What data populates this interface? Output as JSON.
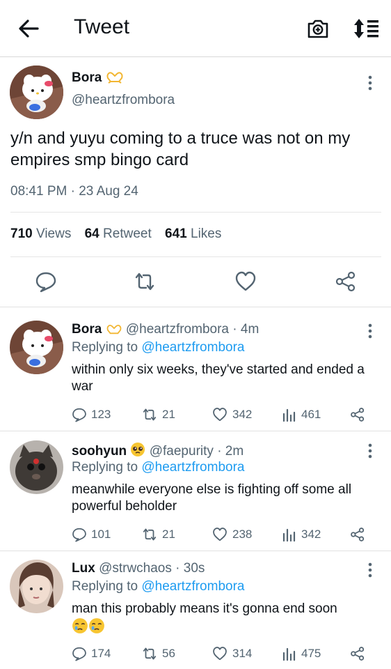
{
  "header": {
    "title": "Tweet"
  },
  "tweet": {
    "author": {
      "name": "Bora",
      "name_emoji": "heart-hands-emoji",
      "handle": "@heartzfrombora"
    },
    "text": "y/n and yuyu coming to a truce was not on my empires smp bingo card",
    "timestamp": "08:41 PM · 23 Aug 24",
    "stats": {
      "views_count": "710",
      "views_label": "Views",
      "retweet_count": "64",
      "retweet_label": "Retweet",
      "likes_count": "641",
      "likes_label": "Likes"
    }
  },
  "replies": [
    {
      "name": "Bora",
      "name_emoji": "heart-hands-emoji",
      "handle": "@heartzfrombora",
      "time": "· 4m",
      "replying_prefix": "Replying to",
      "replying_to": "@heartzfrombora",
      "text": "within only six weeks, they've started and ended a war",
      "reply_count": "123",
      "retweet_count": "21",
      "like_count": "342",
      "view_count": "461"
    },
    {
      "name": "soohyun",
      "name_emoji": "pleading-face-emoji",
      "handle": "@faepurity",
      "time": "· 2m",
      "replying_prefix": "Replying to",
      "replying_to": "@heartzfrombora",
      "text": "meanwhile everyone else is fighting off some all powerful beholder",
      "reply_count": "101",
      "retweet_count": "21",
      "like_count": "238",
      "view_count": "342"
    },
    {
      "name": "Lux",
      "handle": "@strwchaos",
      "time": "· 30s",
      "replying_prefix": "Replying to",
      "replying_to": "@heartzfrombora",
      "text": "man this probably means it's gonna end soon",
      "text_emojis": [
        "crying-face-emoji",
        "crying-face-emoji"
      ],
      "reply_count": "174",
      "retweet_count": "56",
      "like_count": "314",
      "view_count": "475"
    }
  ],
  "colors": {
    "text_primary": "#0f1419",
    "text_secondary": "#536471",
    "link": "#1d9bf0",
    "divider": "#e1e1e1"
  }
}
